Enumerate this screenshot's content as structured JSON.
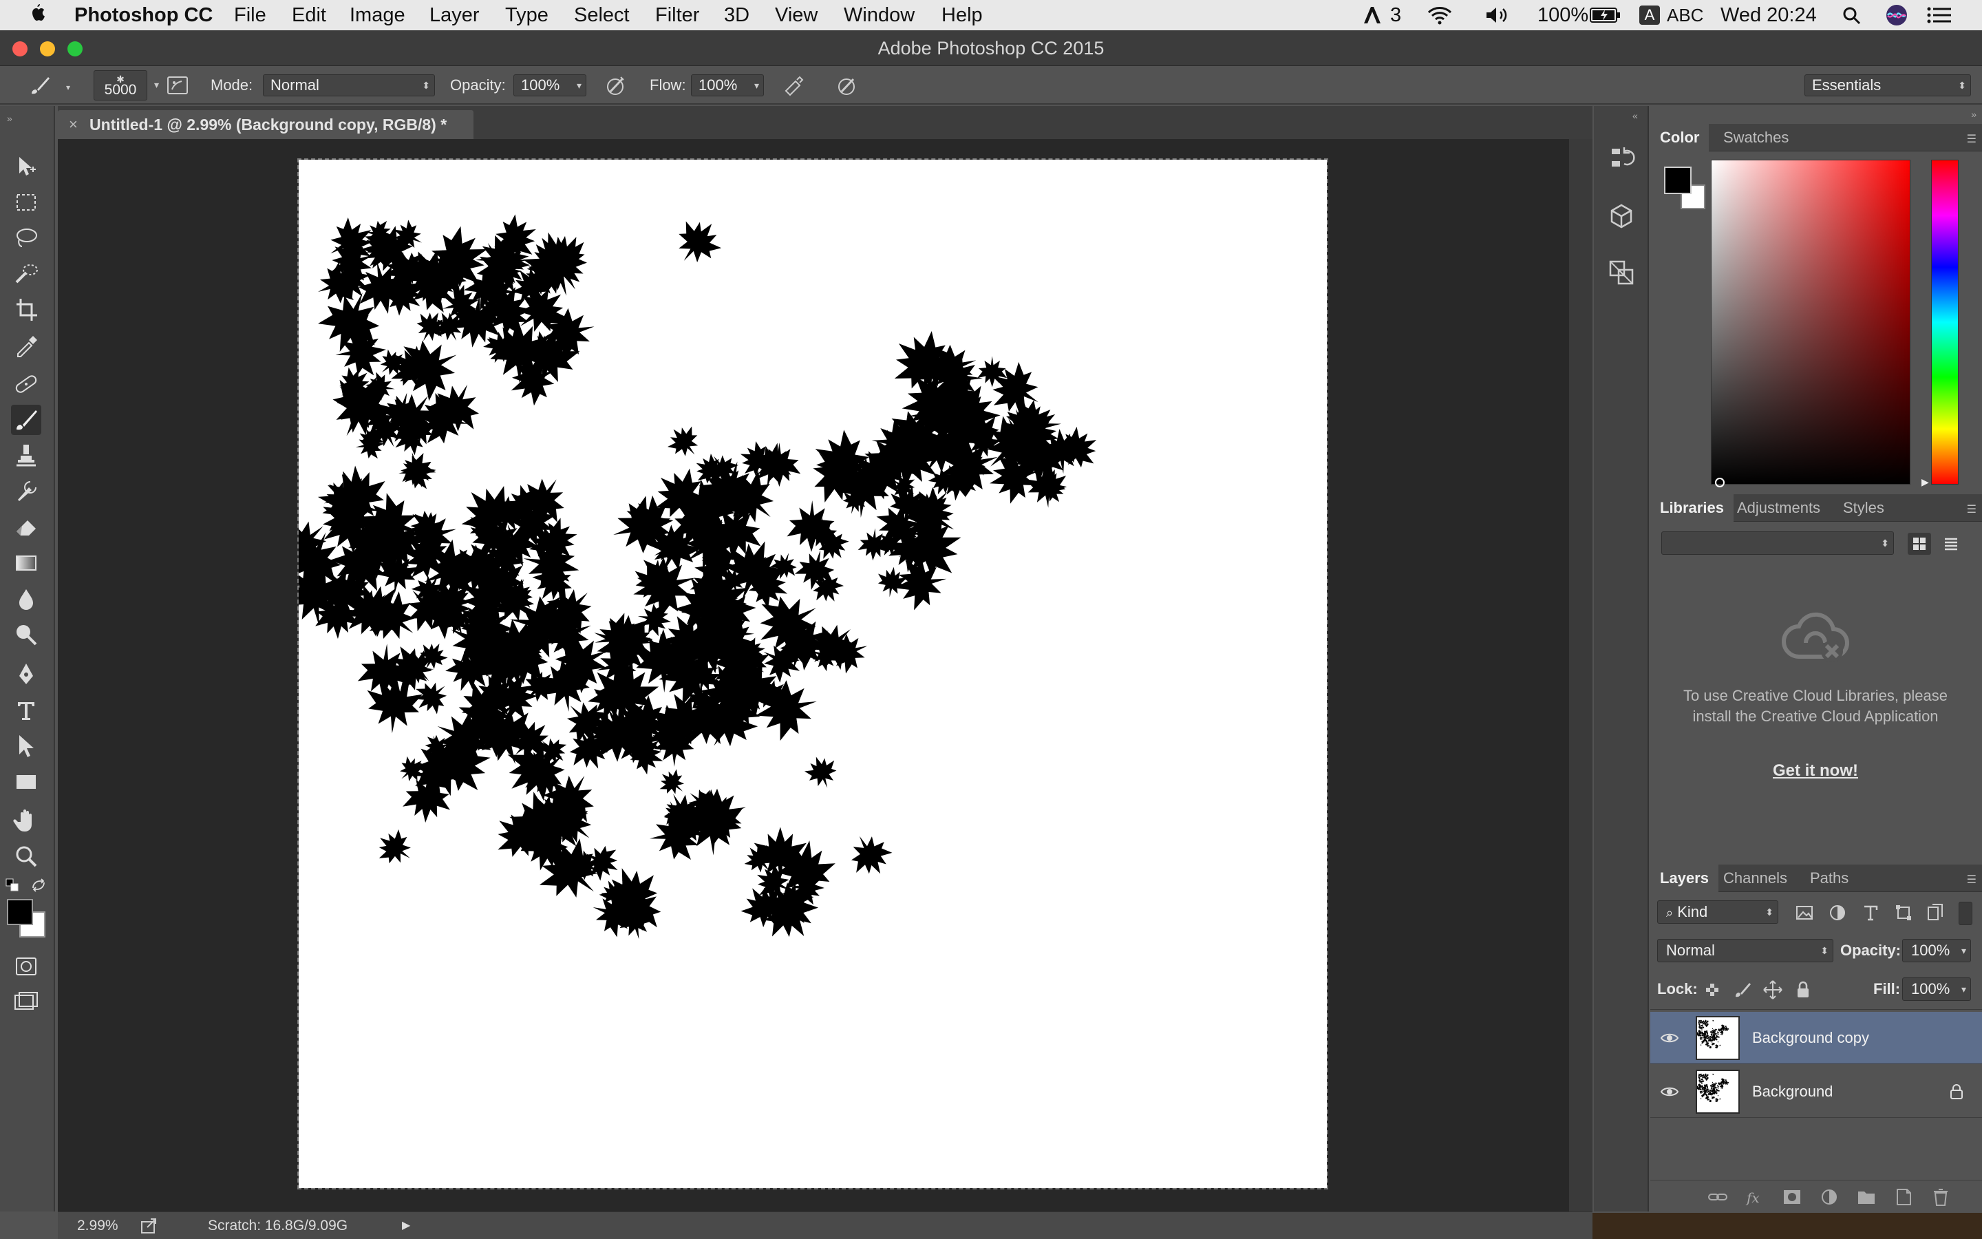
{
  "menubar": {
    "app_name": "Photoshop CC",
    "items": [
      "File",
      "Edit",
      "Image",
      "Layer",
      "Type",
      "Select",
      "Filter",
      "3D",
      "View",
      "Window",
      "Help"
    ],
    "status": {
      "adobe_badge": "3",
      "battery": "100%",
      "input_source": "ABC",
      "input_badge": "A",
      "clock": "Wed 20:24"
    }
  },
  "window": {
    "title": "Adobe Photoshop CC 2015"
  },
  "options_bar": {
    "brush_size": "5000",
    "mode_label": "Mode:",
    "mode_value": "Normal",
    "opacity_label": "Opacity:",
    "opacity_value": "100%",
    "flow_label": "Flow:",
    "flow_value": "100%",
    "workspace": "Essentials"
  },
  "document": {
    "tab_close": "×",
    "tab_label": "Untitled-1 @ 2.99% (Background copy, RGB/8) *"
  },
  "tools": [
    "move-tool",
    "marquee-tool",
    "lasso-tool",
    "quick-selection-tool",
    "crop-tool",
    "eyedropper-tool",
    "healing-brush-tool",
    "brush-tool",
    "clone-stamp-tool",
    "history-brush-tool",
    "eraser-tool",
    "gradient-tool",
    "blur-tool",
    "dodge-tool",
    "pen-tool",
    "type-tool",
    "path-selection-tool",
    "rectangle-tool",
    "hand-tool",
    "zoom-tool"
  ],
  "status_bar": {
    "zoom": "2.99%",
    "scratch": "Scratch: 16.8G/9.09G"
  },
  "color_panel": {
    "tabs": [
      "Color",
      "Swatches"
    ],
    "foreground": "#000000",
    "background": "#ffffff",
    "hue": "#ff0000"
  },
  "libraries_panel": {
    "tabs": [
      "Libraries",
      "Adjustments",
      "Styles"
    ],
    "message": "To use Creative Cloud Libraries, please install the Creative Cloud Application",
    "link": "Get it now!"
  },
  "layers_panel": {
    "tabs": [
      "Layers",
      "Channels",
      "Paths"
    ],
    "filter_kind": "Kind",
    "blend_mode": "Normal",
    "opacity_label": "Opacity:",
    "opacity_value": "100%",
    "lock_label": "Lock:",
    "fill_label": "Fill:",
    "fill_value": "100%",
    "layers": [
      {
        "name": "Background copy",
        "selected": true,
        "locked": false
      },
      {
        "name": "Background",
        "selected": false,
        "locked": true
      }
    ]
  }
}
